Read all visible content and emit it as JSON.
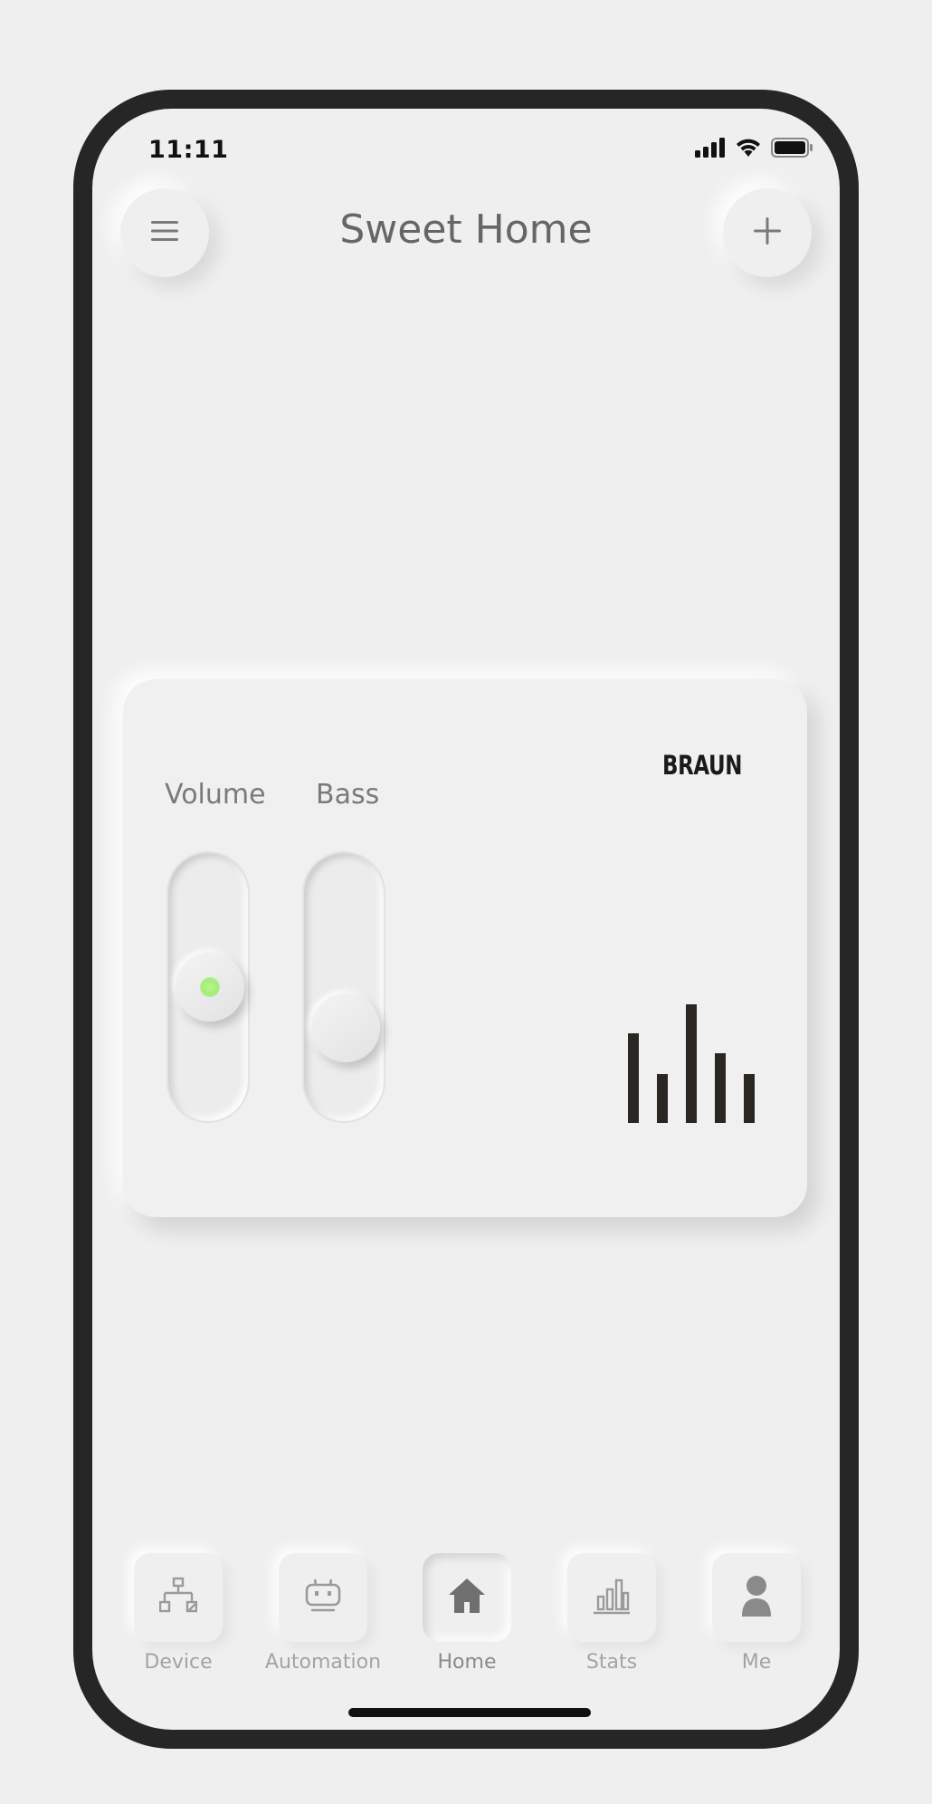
{
  "status_bar": {
    "time": "11:11"
  },
  "header": {
    "title": "Sweet Home",
    "menu_icon": "hamburger-menu-icon",
    "add_icon": "plus-icon"
  },
  "card": {
    "brand": "BRAUN",
    "sliders": [
      {
        "label": "Volume",
        "level": 0.5,
        "indicator_on": true
      },
      {
        "label": "Bass",
        "level": 0.28,
        "indicator_on": false
      }
    ],
    "equalizer_levels": [
      0.58,
      0.32,
      0.77,
      0.45,
      0.32
    ],
    "colors": {
      "indicator": "#a4ec78",
      "equalizer": "#2a2622"
    }
  },
  "nav": {
    "items": [
      {
        "label": "Device",
        "icon": "network-icon",
        "active": false
      },
      {
        "label": "Automation",
        "icon": "robot-icon",
        "active": false
      },
      {
        "label": "Home",
        "icon": "home-icon",
        "active": true
      },
      {
        "label": "Stats",
        "icon": "bar-chart-icon",
        "active": false
      },
      {
        "label": "Me",
        "icon": "user-icon",
        "active": false
      }
    ]
  }
}
